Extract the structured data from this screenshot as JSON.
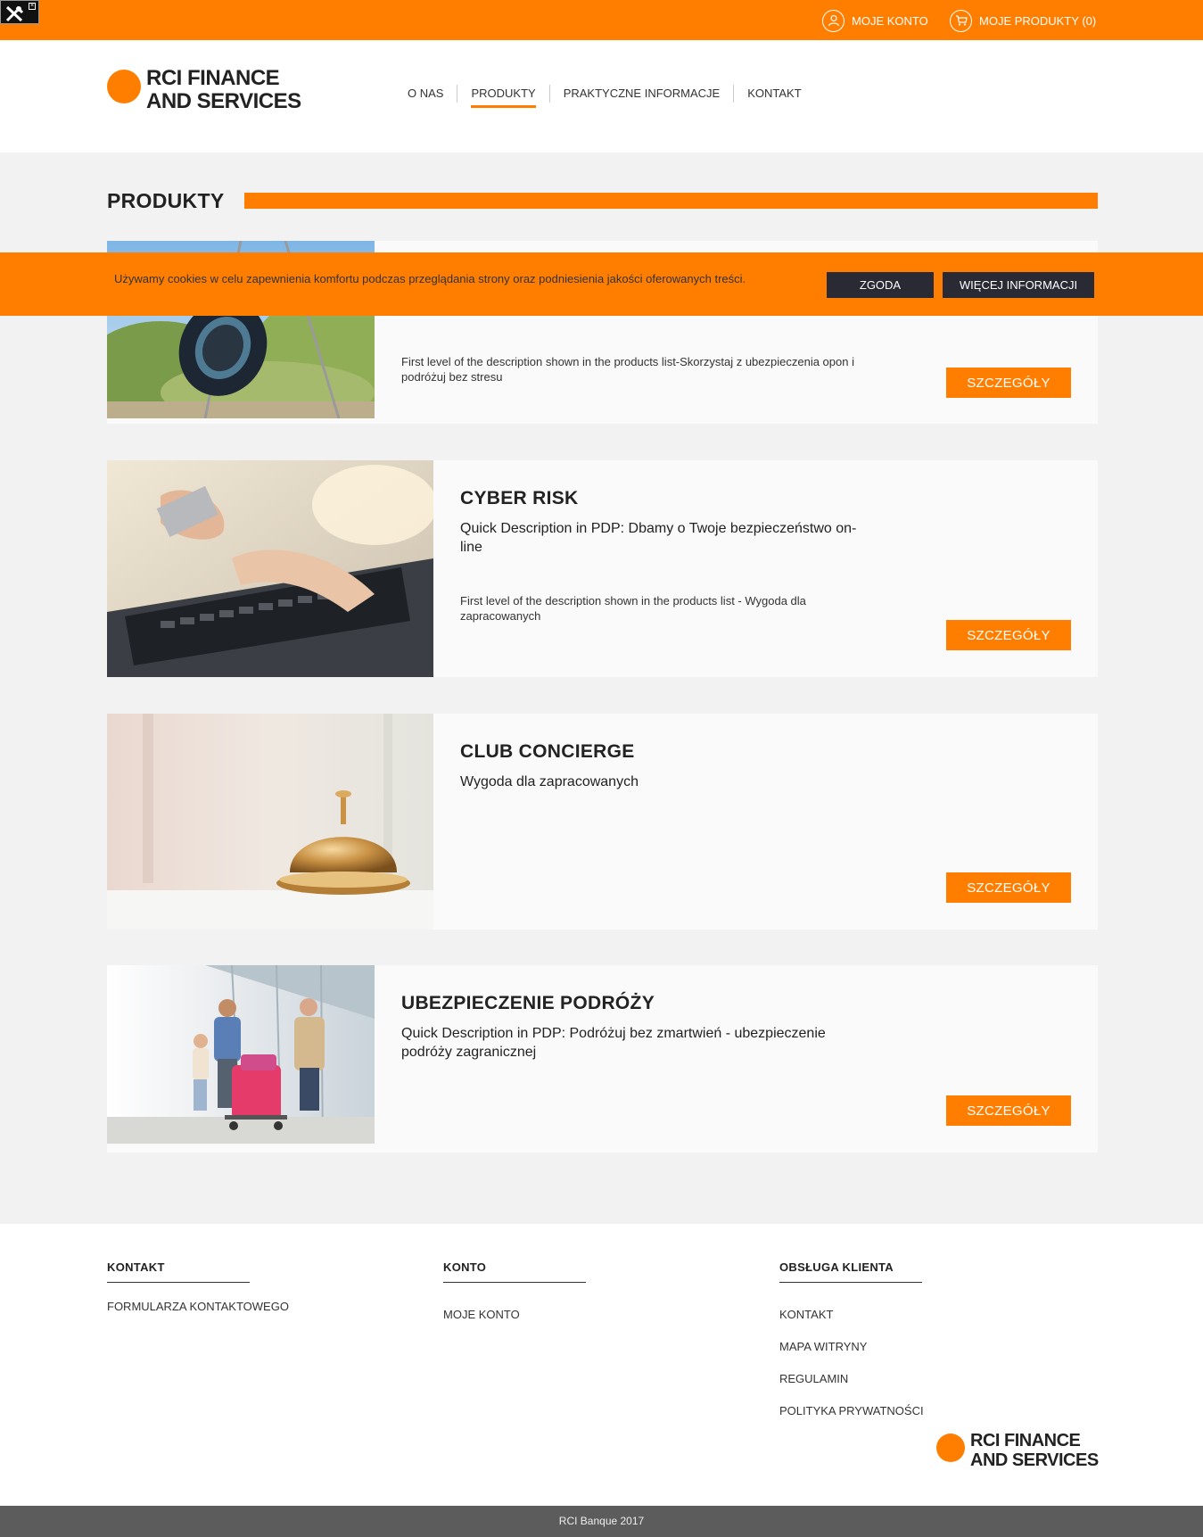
{
  "topbar": {
    "account_label": "MOJE KONTO",
    "cart_label": "MOJE PRODUKTY (0)"
  },
  "logo": {
    "line1": "RCI FINANCE",
    "line2": "AND SERVICES"
  },
  "nav": {
    "items": [
      "O NAS",
      "PRODUKTY",
      "PRAKTYCZNE INFORMACJE",
      "KONTAKT"
    ],
    "active": "PRODUKTY"
  },
  "page_title": "PRODUKTY",
  "cookie": {
    "text": "Używamy cookies w celu zapewnienia komfortu podczas przeglądania strony oraz podniesienia jakości oferowanych treści.",
    "accept_label": "ZGODA",
    "more_label": "WIĘCEJ INFORMACJI"
  },
  "products": [
    {
      "title": "",
      "quick": "",
      "desc": "First level of the description shown in the products list-Skorzystaj z ubezpieczenia opon i podróżuj bez stresu",
      "button": "SZCZEGÓŁY",
      "image": "tire-image"
    },
    {
      "title": "CYBER RISK",
      "quick": "Quick Description in PDP: Dbamy o Twoje bezpieczeństwo on-line",
      "desc": "First level of the description shown in the products list - Wygoda dla zapracowanych",
      "button": "SZCZEGÓŁY",
      "image": "laptop-typing-image"
    },
    {
      "title": "CLUB CONCIERGE",
      "quick": "Wygoda dla zapracowanych",
      "desc": "",
      "button": "SZCZEGÓŁY",
      "image": "service-bell-image"
    },
    {
      "title": "UBEZPIECZENIE PODRÓŻY",
      "quick": "Quick Description in PDP: Podróżuj bez zmartwień - ubezpieczenie podróży zagranicznej",
      "desc": "",
      "button": "SZCZEGÓŁY",
      "image": "family-travel-image"
    }
  ],
  "footer": {
    "columns": [
      {
        "heading": "KONTAKT",
        "links": [
          "FORMULARZA KONTAKTOWEGO"
        ]
      },
      {
        "heading": "KONTO",
        "links": [
          "MOJE KONTO"
        ]
      },
      {
        "heading": "OBSŁUGA KLIENTA",
        "links": [
          "KONTAKT",
          "MAPA WITRYNY",
          "REGULAMIN",
          "POLITYKA PRYWATNOŚCI"
        ]
      }
    ],
    "copyright": "RCI Banque 2017"
  },
  "colors": {
    "brand_orange": "#ff7e00",
    "dark_button": "#2a2a35",
    "footer_bar": "#5c5c5c"
  }
}
